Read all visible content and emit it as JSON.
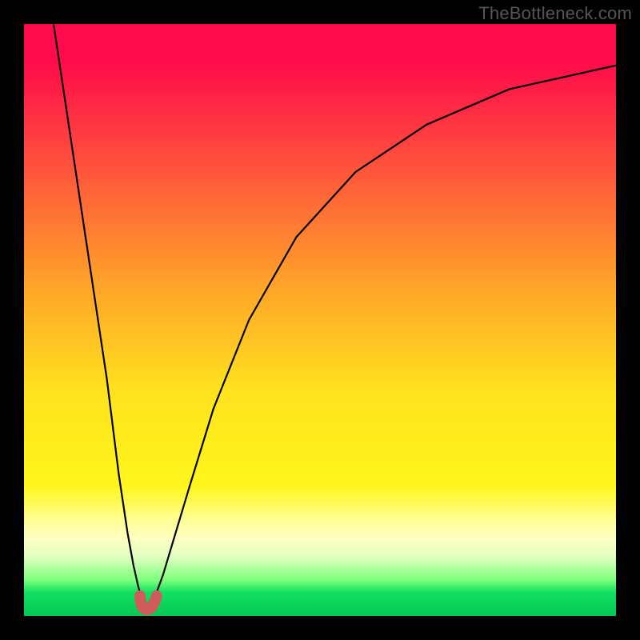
{
  "watermark": "TheBottleneck.com",
  "chart_data": {
    "type": "line",
    "title": "",
    "xlabel": "",
    "ylabel": "",
    "xlim": [
      0,
      100
    ],
    "ylim": [
      0,
      100
    ],
    "grid": false,
    "background_gradient": {
      "direction": "vertical",
      "stops": [
        {
          "pos": 0,
          "color": "#ff0a4a"
        },
        {
          "pos": 22,
          "color": "#ff4a3e"
        },
        {
          "pos": 44,
          "color": "#ffa329"
        },
        {
          "pos": 62,
          "color": "#ffe21e"
        },
        {
          "pos": 78,
          "color": "#fff61c"
        },
        {
          "pos": 88,
          "color": "#ffffc3"
        },
        {
          "pos": 94,
          "color": "#7aff7a"
        },
        {
          "pos": 100,
          "color": "#05c755"
        }
      ]
    },
    "series": [
      {
        "name": "curve-left",
        "stroke": "#000000",
        "x": [
          5,
          8,
          11,
          14,
          16,
          17.5,
          18.5,
          19.3,
          19.8,
          20.2
        ],
        "y": [
          100,
          80,
          60,
          40,
          24,
          14,
          8.5,
          5,
          3.2,
          2.5
        ]
      },
      {
        "name": "curve-right",
        "stroke": "#000000",
        "x": [
          21.8,
          22.4,
          23.5,
          25,
          28,
          32,
          38,
          46,
          56,
          68,
          82,
          100
        ],
        "y": [
          2.5,
          4,
          7,
          12,
          22,
          35,
          50,
          64,
          75,
          83,
          89,
          93
        ]
      },
      {
        "name": "marker-u",
        "stroke": "#cf5b5b",
        "x": [
          19.6,
          19.7,
          20.0,
          20.5,
          21.0,
          21.6,
          22.0,
          22.3,
          22.4
        ],
        "y": [
          3.4,
          2.3,
          1.5,
          1.1,
          1.1,
          1.5,
          2.3,
          3.0,
          3.4
        ]
      }
    ],
    "annotations": []
  }
}
